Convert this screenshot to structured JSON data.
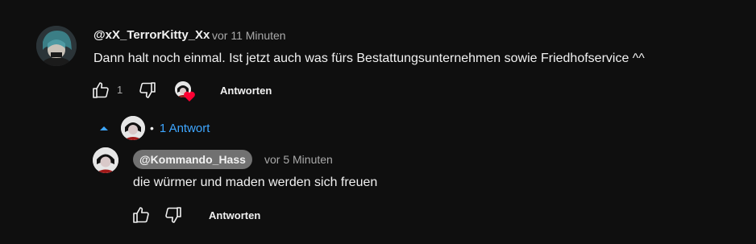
{
  "comment": {
    "author": "@xX_TerrorKitty_Xx",
    "time": "vor 11 Minuten",
    "text": "Dann halt noch einmal. Ist jetzt auch was fürs Bestattungsunternehmen sowie Friedhofservice ^^",
    "like_count": "1",
    "reply_label": "Antworten"
  },
  "replies_toggle": {
    "dot": "•",
    "label": "1 Antwort",
    "icon": "caret-up-icon"
  },
  "reply": {
    "author": "@Kommando_Hass",
    "time": "vor 5 Minuten",
    "text": "die würmer und maden werden sich freuen",
    "reply_label": "Antworten"
  },
  "colors": {
    "background": "#0f0f0f",
    "link_blue": "#3ea6ff",
    "heart_red": "#ff0033",
    "chip_bg": "#717171"
  }
}
